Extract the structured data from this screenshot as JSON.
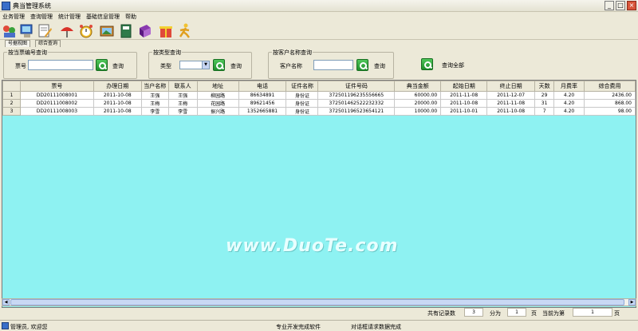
{
  "window": {
    "title": "典当管理系统"
  },
  "menu": [
    "业务管理",
    "查询管理",
    "统计管理",
    "基础信息管理",
    "帮助"
  ],
  "toolbar_icons": [
    "people-icon",
    "computer-icon",
    "edit-note-icon",
    "umbrella-icon",
    "alarm-clock-icon",
    "picture-icon",
    "notebook-icon",
    "book-icon",
    "gift-box-icon",
    "running-person-icon"
  ],
  "tabs": [
    "号据视图",
    "综合查询"
  ],
  "search": {
    "by_ticket": {
      "group": "按当票编号查询",
      "label": "票号",
      "button": "查询"
    },
    "by_type": {
      "group": "按类型查询",
      "label": "类型",
      "button": "查询"
    },
    "by_customer": {
      "group": "按客户名称查询",
      "label": "客户名称",
      "button": "查询"
    },
    "all_button": "查询全部"
  },
  "table": {
    "columns": [
      "票号",
      "办理日期",
      "当户名称",
      "联系人",
      "地址",
      "电话",
      "证件名称",
      "证件号码",
      "典当金额",
      "起始日期",
      "终止日期",
      "天数",
      "月费率",
      "综合费用"
    ],
    "rows": [
      {
        "rn": "1",
        "cells": [
          "DD20111008001",
          "2011-10-08",
          "王强",
          "王强",
          "柳园路",
          "86634891",
          "身份证",
          "372501196235556665",
          "60000.00",
          "2011-11-08",
          "2011-12-07",
          "29",
          "4.20",
          "2436.00"
        ]
      },
      {
        "rn": "2",
        "cells": [
          "DD20111008002",
          "2011-10-08",
          "王梅",
          "王梅",
          "花园路",
          "89621456",
          "身份证",
          "372501462522232332",
          "20000.00",
          "2011-10-08",
          "2011-11-08",
          "31",
          "4.20",
          "868.00"
        ]
      },
      {
        "rn": "3",
        "cells": [
          "DD20111008003",
          "2011-10-08",
          "李雪",
          "李雪",
          "振兴路",
          "1352665881",
          "身份证",
          "372501196523654121",
          "10000.00",
          "2011-10-01",
          "2011-10-08",
          "7",
          "4.20",
          "98.00"
        ]
      }
    ]
  },
  "watermark": "www.DuoTe.com",
  "pager": {
    "total_label": "共有记录数",
    "total": "3",
    "pages_label": "分为",
    "pages": "1",
    "page_unit": "页",
    "current_label": "当前为第",
    "current": "1"
  },
  "status": {
    "user": "管理员, 欢迎您",
    "developer": "专业开发完成软件",
    "message": "对话框请求数据完成"
  }
}
